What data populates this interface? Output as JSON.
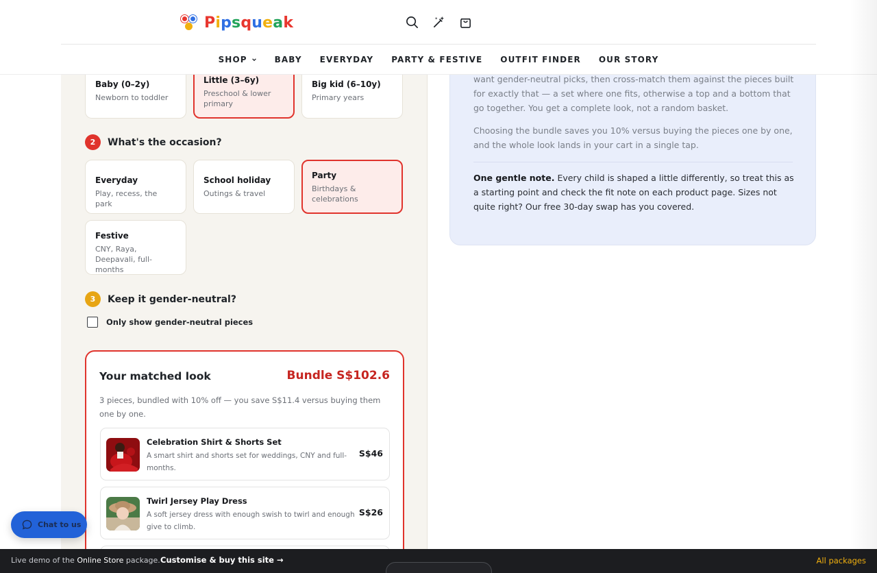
{
  "brand": {
    "name_letters": [
      "P",
      "i",
      "p",
      "s",
      "q",
      "u",
      "e",
      "a",
      "k"
    ],
    "letter_colors": [
      "#e8372f",
      "#f1b00f",
      "#2f6fe3",
      "#22a35a",
      "#e8372f",
      "#2f6fe3",
      "#f1b00f",
      "#22a35a",
      "#e8372f"
    ]
  },
  "header": {
    "icons": [
      "search-icon",
      "magic-wand-icon",
      "shopping-bag-icon"
    ],
    "nav": [
      {
        "label": "SHOP",
        "has_dropdown": true
      },
      {
        "label": "BABY"
      },
      {
        "label": "EVERYDAY"
      },
      {
        "label": "PARTY & FESTIVE"
      },
      {
        "label": "OUTFIT FINDER"
      },
      {
        "label": "OUR STORY"
      }
    ]
  },
  "quiz": {
    "age_cards": [
      {
        "title": "Baby (0–2y)",
        "desc": "Newborn to toddler",
        "selected": false
      },
      {
        "title": "Little (3–6y)",
        "desc": "Preschool & lower primary",
        "selected": true
      },
      {
        "title": "Big kid (6–10y)",
        "desc": "Primary years",
        "selected": false
      }
    ],
    "step2": {
      "number": "2",
      "title": "What's the occasion?",
      "color": "#e0332c"
    },
    "occasion_cards": [
      {
        "title": "Everyday",
        "desc": "Play, recess, the park",
        "selected": false
      },
      {
        "title": "School holiday",
        "desc": "Outings & travel",
        "selected": false
      },
      {
        "title": "Party",
        "desc": "Birthdays & celebrations",
        "selected": true
      },
      {
        "title": "Festive",
        "desc": "CNY, Raya, Deepavali, full-months",
        "selected": false
      }
    ],
    "step3": {
      "number": "3",
      "title": "Keep it gender-neutral?",
      "color": "#e7a514"
    },
    "gender_neutral": {
      "label": "Only show gender-neutral pieces",
      "checked": false
    }
  },
  "matched_look": {
    "title": "Your matched look",
    "bundle": "Bundle S$102.6",
    "subtitle": "3 pieces, bundled with 10% off — you save S$11.4 versus buying them one by one.",
    "products": [
      {
        "name": "Celebration Shirt & Shorts Set",
        "desc": "A smart shirt and shorts set for weddings, CNY and full-months.",
        "price": "S$46"
      },
      {
        "name": "Twirl Jersey Play Dress",
        "desc": "A soft jersey dress with enough swish to twirl and enough give to climb.",
        "price": "S$26"
      }
    ]
  },
  "info_panel": {
    "para1": "want gender-neutral picks, then cross-match them against the pieces built for exactly that — a set where one fits, otherwise a top and a bottom that go together. You get a complete look, not a random basket.",
    "para2": "Choosing the bundle saves you 10% versus buying the pieces one by one, and the whole look lands in your cart in a single tap.",
    "note_bold": "One gentle note.",
    "note_text": " Every child is shaped a little differently, so treat this as a starting point and check the fit note on each product page. Sizes not quite right? Our free 30-day swap has you covered."
  },
  "chat": {
    "label": "Chat to us"
  },
  "bottom_bar": {
    "prefix": "Live demo of the ",
    "package": "Online Store",
    "suffix": " package.",
    "cta": "Customise & buy this site →",
    "right": "All packages"
  }
}
